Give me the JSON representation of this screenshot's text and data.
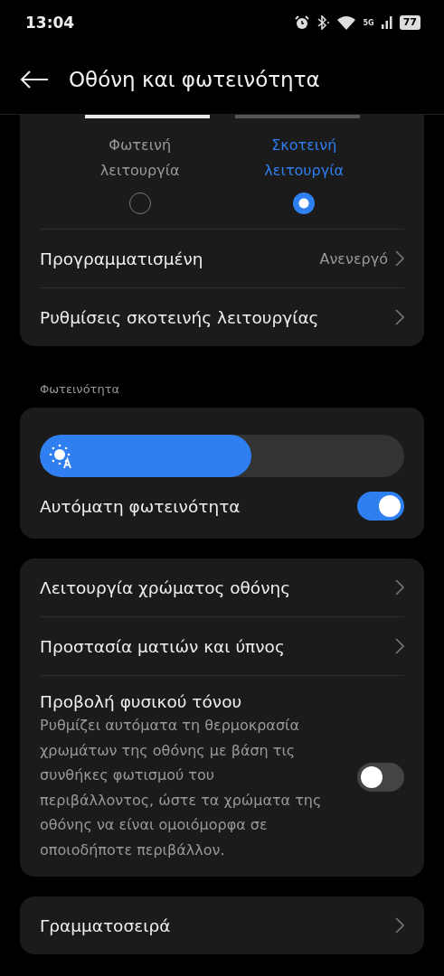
{
  "status_bar": {
    "time": "13:04",
    "network": "5G",
    "battery": "77"
  },
  "header": {
    "title": "Οθόνη και φωτεινότητα"
  },
  "theme_modes": [
    {
      "kind": "light",
      "label": "Φωτεινή λειτουργία",
      "selected": false
    },
    {
      "kind": "dark",
      "label": "Σκοτεινή λειτουργία",
      "selected": true
    }
  ],
  "theme_rows": [
    {
      "label": "Προγραμματισμένη",
      "value": "Ανενεργό"
    },
    {
      "label": "Ρυθμίσεις σκοτεινής λειτουργίας"
    }
  ],
  "brightness": {
    "section_title": "Φωτεινότητα",
    "level": 0.58,
    "auto": {
      "label": "Αυτόματη φωτεινότητα",
      "on": true
    }
  },
  "display_rows": [
    {
      "kind": "link",
      "label": "Λειτουργία χρώματος οθόνης"
    },
    {
      "kind": "link",
      "label": "Προστασία ματιών και ύπνος"
    },
    {
      "kind": "switch",
      "label": "Προβολή φυσικού τόνου",
      "description": "Ρυθμίζει αυτόματα τη θερμοκρασία χρωμάτων της οθόνης με βάση τις συνθήκες φωτισμού του περιβάλλοντος, ώστε τα χρώματα της οθόνης να είναι ομοιόμορφα σε οποιοδήποτε περιβάλλον.",
      "on": false
    }
  ],
  "more_rows": [
    {
      "label": "Γραμματοσειρά"
    }
  ]
}
